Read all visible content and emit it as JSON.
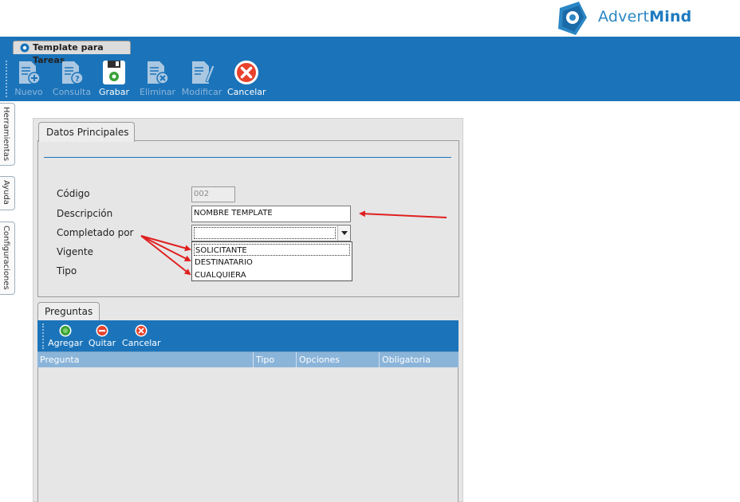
{
  "brand": {
    "name_light": "Advert",
    "name_bold": "Mind",
    "color": "#2b86c4"
  },
  "window_tab": {
    "title": "Template para Tareas"
  },
  "toolbar": {
    "buttons": [
      {
        "label": "Nuevo",
        "icon": "new-document-icon",
        "enabled": false
      },
      {
        "label": "Consulta",
        "icon": "query-document-icon",
        "enabled": false
      },
      {
        "label": "Grabar",
        "icon": "save-icon",
        "enabled": true
      },
      {
        "label": "Eliminar",
        "icon": "delete-document-icon",
        "enabled": false
      },
      {
        "label": "Modificar",
        "icon": "edit-document-icon",
        "enabled": false
      },
      {
        "label": "Cancelar",
        "icon": "cancel-icon",
        "enabled": true
      }
    ]
  },
  "side_tabs": [
    "Herramientas",
    "Ayuda",
    "Configuraciones"
  ],
  "datos_principales": {
    "tab_label": "Datos Principales",
    "fields": {
      "codigo": {
        "label": "Código",
        "value": "002"
      },
      "descripcion": {
        "label": "Descripción",
        "value": "NOMBRE TEMPLATE"
      },
      "completado_por": {
        "label": "Completado por",
        "value": ""
      },
      "vigente": {
        "label": "Vigente"
      },
      "tipo": {
        "label": "Tipo"
      }
    },
    "completado_options": [
      "SOLICITANTE",
      "DESTINATARIO",
      "CUALQUIERA"
    ]
  },
  "preguntas": {
    "tab_label": "Preguntas",
    "toolbar": [
      {
        "label": "Agregar",
        "icon": "add-icon"
      },
      {
        "label": "Quitar",
        "icon": "remove-icon"
      },
      {
        "label": "Cancelar",
        "icon": "cancel-icon"
      }
    ],
    "columns": [
      "Pregunta",
      "Tipo",
      "Opciones",
      "Obligatoria"
    ],
    "rows": []
  },
  "colors": {
    "toolbar_blue": "#1b74ba",
    "grid_header": "#8bb4d9",
    "annotation_red": "#e02020"
  }
}
